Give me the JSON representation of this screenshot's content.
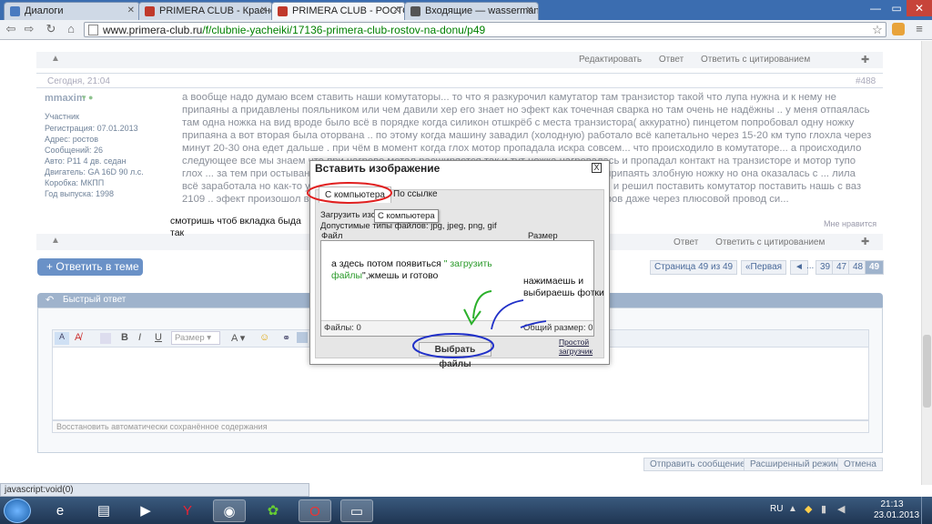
{
  "browser": {
    "tabs": [
      {
        "title": "Диалоги",
        "fav_color": "#4a7bc0"
      },
      {
        "title": "PRIMERA CLUB - Краснод",
        "fav_color": "#c0392b"
      },
      {
        "title": "PRIMERA CLUB - РОСТОВ",
        "fav_color": "#c0392b"
      },
      {
        "title": "Входящие — wasserman",
        "fav_color": "#555555"
      }
    ],
    "window_controls": {
      "minimize": "—",
      "maximize": "▭",
      "close": "✕"
    },
    "url_host": "www.primera-club.ru",
    "url_path": "/f/clubnie-yacheiki/17136-primera-club-rostov-na-donu/p49"
  },
  "post_top": {
    "actions": [
      "Редактировать",
      "Ответ",
      "Ответить с цитированием"
    ]
  },
  "post": {
    "date": "Сегодня, 21:04",
    "number": "#488",
    "username": "mmaxim",
    "role": "Участник",
    "details": [
      "Регистрация: 07.01.2013",
      "Адрес: ростов",
      "Сообщений: 26",
      "Авто: P11 4 дв. седан",
      "Двигатель: GA 16D 90 л.с.",
      "Коробка: МКПП",
      "Год выпуска: 1998"
    ],
    "text": "а вообще надо думаю всем ставить наши комутаторы... то что я разкурочил камутатор там транзистор такой что лупа нужна и к нему не припаяны а придавлены пояльником или чем давили хер его знает но эфект как точечная сварка но там очень не надёжны .. у меня отпаялась там одна ножка на вид вроде было всё в порядке когда силикон отшкрёб с места транзистора( аккуратно) пинцетом попробовал одну ножку припаяна а вот вторая была оторвана .. по этому когда машину завадил (холодную) работало всё капетально через 15-20 км тупо глохла через минут 20-30 она едет дальше . при чём в момент когда глох мотор пропадала искра совсем... что происходило в комутаторе... а происходило следующее все мы знаем что при нагреве метал расширяется так и тут ножка нагревалась и пропадал контакт на транзисторе и мотор тупо глох ... за тем при остывании ... возрастало сопротивление .. оценив проблему я решил припаять злобную ножку но она оказалась с ... лила всё заработала но как-то уже и не хочу осмотрев сопельные соеденения присутствуют ... и решил поставить комутатор поставить нашь с ваз 2109 .. эфект произошол все мои ожидания ... лупить стала на растоянии двух сантиметров даже через плюсовой провод си...",
    "likes": "Мне нравится",
    "actions": [
      "Ответ",
      "Ответить с цитированием"
    ]
  },
  "reply_button": "+ Ответить в теме",
  "pagination": {
    "label": "Страница 49 из 49",
    "first": "«Первая",
    "prev": "◄",
    "ellipsis": "...",
    "pages": [
      "39",
      "47",
      "48",
      "49"
    ]
  },
  "quick_reply": {
    "title": "Быстрый ответ",
    "size_placeholder": "Размер",
    "restore_link": "Восстановить автоматически сохранённое содержания",
    "buttons": [
      "Отправить сообщение",
      "Расширенный режим",
      "Отмена"
    ]
  },
  "dialog": {
    "title": "Вставить изображение",
    "close": "X",
    "tabs": [
      "С компьютера",
      "По ссылке"
    ],
    "upload_label": "Загрузить изо... пьютера",
    "allowed_types": "Допустимые типы файлов: jpg, jpeg, png, gif",
    "col_file": "Файл",
    "col_size": "Размер",
    "files_count": "Файлы: 0",
    "total_size": "Общий размер: 0",
    "select_button": "Выбрать файлы",
    "simple_uploader": "Простой загрузчик",
    "tooltip": "С компьютера"
  },
  "annotations": {
    "tab_hint_1": "смотришь чтоб вкладка быда",
    "tab_hint_2": "так",
    "upload_hint_a": "а здесь потом появиться ",
    "upload_hint_b": "\" загрузить",
    "upload_hint_c": "файлы",
    "upload_hint_d": "\",жмешь и готово",
    "click_hint_1": "нажимаешь и",
    "click_hint_2": "выбираешь фотки"
  },
  "status_text": "javascript:void(0)",
  "tray": {
    "lang": "RU",
    "time": "21:13",
    "date": "23.01.2013"
  }
}
